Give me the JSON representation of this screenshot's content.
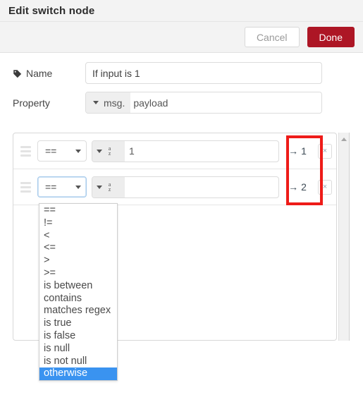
{
  "dialog": {
    "title": "Edit switch node",
    "buttons": {
      "cancel": "Cancel",
      "done": "Done"
    },
    "accent_red": "#ad1625",
    "annotation_color": "#ee1b18",
    "highlight_color": "#3a93f0"
  },
  "form": {
    "name": {
      "label": "Name",
      "icon": "tag-icon",
      "value": "If input is 1",
      "placeholder": "Name"
    },
    "property": {
      "label": "Property",
      "type_prefix": "msg.",
      "value": "payload"
    }
  },
  "rules": {
    "rows": [
      {
        "operator": "==",
        "value_type_icon": "string-az-icon",
        "value": "1",
        "output": "1",
        "arrow": "→",
        "delete_label": "×",
        "focused": false
      },
      {
        "operator": "==",
        "value_type_icon": "string-az-icon",
        "value": "",
        "output": "2",
        "arrow": "→",
        "delete_label": "×",
        "focused": true
      }
    ]
  },
  "operator_dropdown": {
    "options": [
      "==",
      "!=",
      "<",
      "<=",
      ">",
      ">=",
      "is between",
      "contains",
      "matches regex",
      "is true",
      "is false",
      "is null",
      "is not null",
      "otherwise"
    ],
    "selected": "otherwise"
  },
  "scrollbar": {
    "up_arrow": "scroll-up-arrow-icon"
  }
}
